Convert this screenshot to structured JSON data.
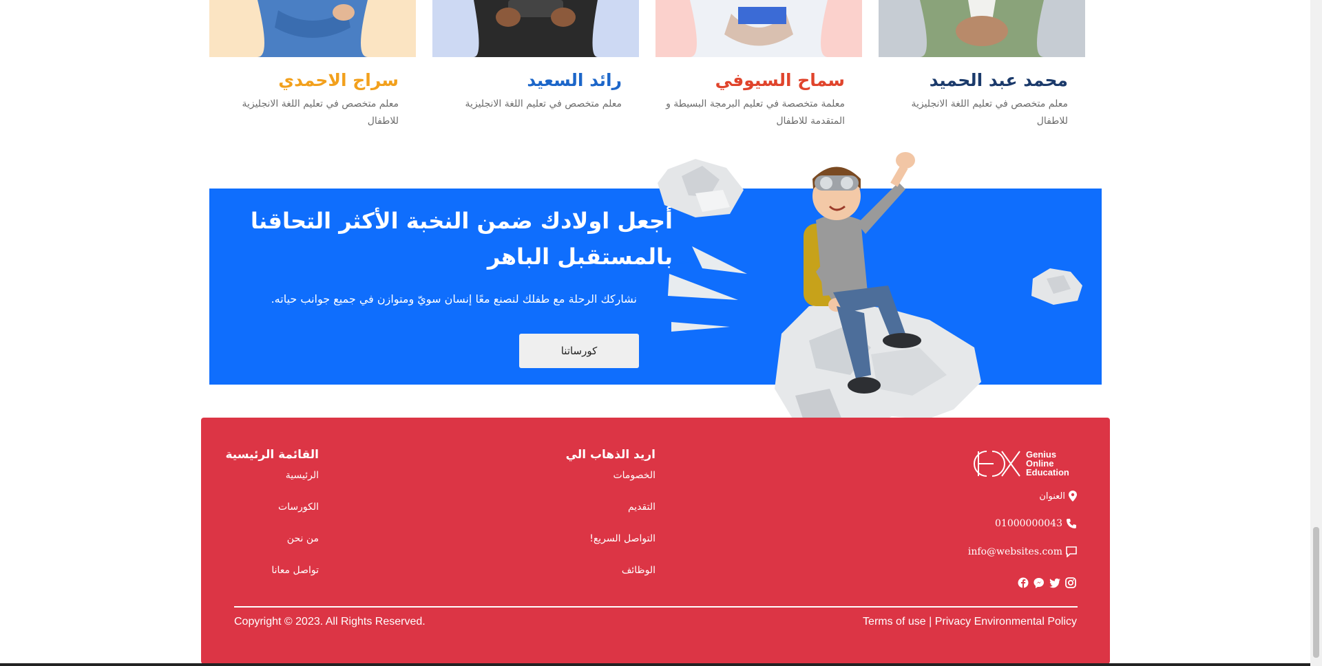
{
  "teachers": [
    {
      "name": "محمد عبد الحميد",
      "description": "معلم متخصص في تعليم اللغة الانجليزية للاطفال",
      "name_color": "#1b3a6b",
      "photo_bg": "#c6ccd3",
      "shirt_color": "#8aa37a"
    },
    {
      "name": "سماح السيوفي",
      "description": "معلمة متخصصة في تعليم البرمجة البسيطة و المتقدمة للاطفال",
      "name_color": "#e0442c",
      "photo_bg": "#fbd1cc",
      "shirt_color": "#eef1f6"
    },
    {
      "name": "رائد السعيد",
      "description": "معلم متخصص في تعليم اللغة الانجليزية",
      "name_color": "#1c66c9",
      "photo_bg": "#cdd9f3",
      "shirt_color": "#2a2a2a"
    },
    {
      "name": "سراج الاحمدي",
      "description": "معلم متخصص في تعليم اللغة الانجليزية للاطفال",
      "name_color": "#f2a01c",
      "photo_bg": "#fbe4c2",
      "shirt_color": "#4a7fc4"
    }
  ],
  "banner": {
    "title": "أجعل اولادك ضمن النخبة الأكثر التحاقنا بالمستقبل الباهر",
    "subtitle": "نشاركك الرحلة مع طفلك لنصنع معًا إنسان سويّ ومتوازن في جميع جوانب حياته.",
    "button": "كورساتنا",
    "color": "#0f6efd"
  },
  "footer": {
    "color": "#dc3545",
    "logo": {
      "line1": "Genius",
      "line2": "Online",
      "line3": "Education"
    },
    "address": "العنوان",
    "phone": "01000000043",
    "email": "info@websites.com",
    "social_icons": [
      "facebook-icon",
      "messenger-icon",
      "twitter-icon",
      "instagram-icon"
    ],
    "col_goto": {
      "title": "اريد الذهاب الي",
      "links": [
        "الخصومات",
        "التقديم",
        "التواصل السريع!",
        "الوظائف"
      ]
    },
    "col_main": {
      "title": "القائمة الرئيسية",
      "links": [
        "الرئيسية",
        "الكورسات",
        "من نحن",
        "تواصل معانا"
      ]
    },
    "copyright": "Copyright © 2023. All Rights Reserved.",
    "terms": "Terms of use",
    "separator": "|",
    "privacy": "Privacy Environmental Policy"
  }
}
